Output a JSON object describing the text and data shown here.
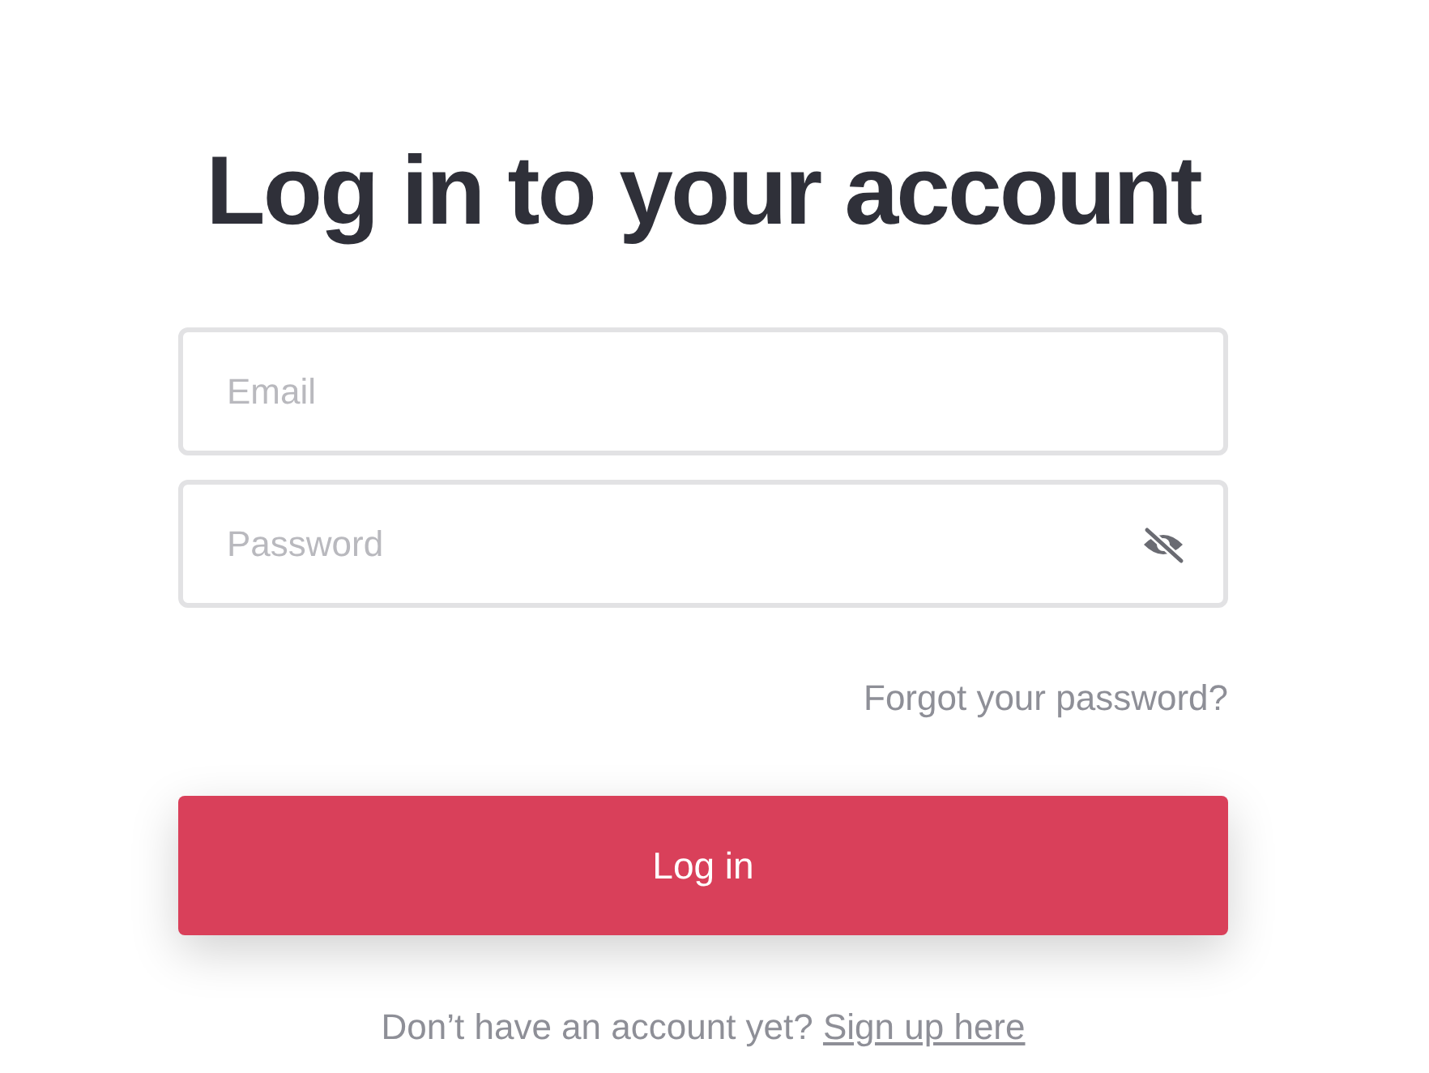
{
  "title": "Log in to your account",
  "fields": [
    {
      "placeholder": "Email",
      "reveal_toggle": false
    },
    {
      "placeholder": "Password",
      "reveal_toggle": true
    }
  ],
  "forgot_link": "Forgot your password?",
  "login_button": "Log in",
  "signup": {
    "text": "Don’t have an account yet?",
    "link": "Sign up here"
  }
}
